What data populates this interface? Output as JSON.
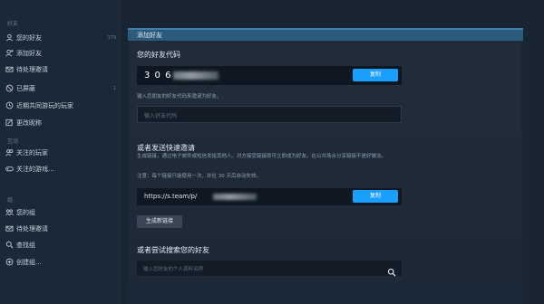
{
  "sidebar": {
    "section1_title": "好友",
    "section2_title": "互动",
    "section3_title": "组",
    "items": [
      {
        "label": "您的好友",
        "icon": "person-icon",
        "count": "179"
      },
      {
        "label": "添加好友",
        "icon": "add-friend-icon"
      },
      {
        "label": "待处理邀请",
        "icon": "envelope-icon"
      },
      {
        "label": "已屏蔽",
        "icon": "blocked-icon",
        "count": "1"
      },
      {
        "label": "近期共同游玩的玩家",
        "icon": "clock-icon"
      },
      {
        "label": "更改昵称",
        "icon": "edit-icon"
      },
      {
        "label": "关注的玩家",
        "icon": "follow-icon"
      },
      {
        "label": "关注的游戏...",
        "icon": "gamepad-icon"
      },
      {
        "label": "您的组",
        "icon": "group-icon"
      },
      {
        "label": "待处理邀请",
        "icon": "envelope-icon"
      },
      {
        "label": "查找组",
        "icon": "search-icon"
      },
      {
        "label": "创建组...",
        "icon": "plus-icon"
      }
    ]
  },
  "panel": {
    "header": "添加好友",
    "code_title": "您的好友代码",
    "code_visible": "3 0 6",
    "copy_label": "复制",
    "code_hint": "输入您朋友的好友代码来邀请为好友。",
    "code_placeholder": "输入好友代码",
    "link_title": "或者发送快速邀请",
    "link_desc": "生成链接，通过电子邮件或短信发给其他人。对方接受链接即可立即成为好友。在公共场合分享链接不是好做法。",
    "link_expiry": "注意：每个链接只能使用一次，并在 30 天后自动失效。",
    "link_url": "https://s.team/p/",
    "new_link_label": "生成新链接",
    "search_title": "或者尝试搜索您的好友",
    "search_placeholder": "输入您好友的个人资料名称"
  },
  "colors": {
    "accent": "#1a9fff",
    "bg": "#1b2838"
  }
}
